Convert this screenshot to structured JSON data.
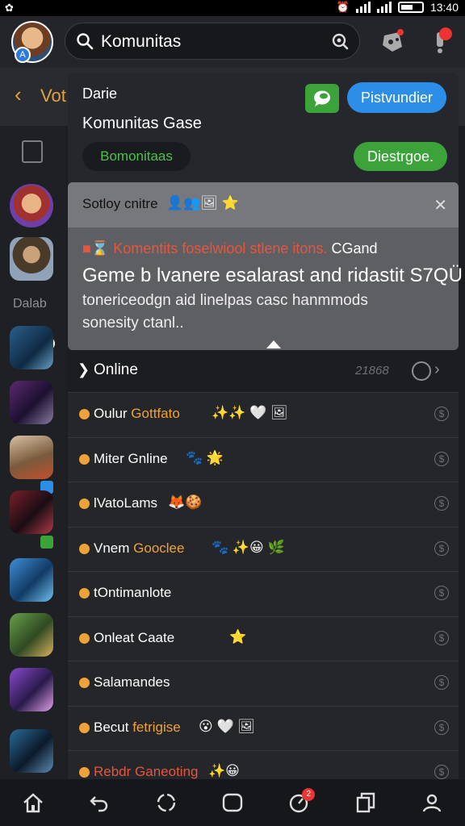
{
  "status_bar": {
    "time": "13:40"
  },
  "header": {
    "search_text": "Komunitas"
  },
  "back_row": {
    "label": "Vot"
  },
  "panel": {
    "title": "Darie",
    "subtitle": "Komunitas Gase",
    "blue_button": "Pistvundier",
    "chip_label": "Bomonitaas",
    "green_button": "Diestrgoe."
  },
  "tooltip": {
    "head_text": "Sotloy cnitre",
    "line1_red": "Komentits foselwiool stlene itons.",
    "line1_white": "CGand",
    "line2": "Geme b lvanere esalarast and ridastit S7QÜ",
    "line3": "tonericeodgn aid linelpas casc hanmmods",
    "line4": "sonesity ctanl.."
  },
  "rail": {
    "label": "Dalab"
  },
  "online": {
    "title": "Online",
    "count": "21868"
  },
  "rows": [
    {
      "name": "Oulur ",
      "accent": "Gottfato",
      "emoji": "✨✨ 🤍 🖼",
      "accent_color": "acc"
    },
    {
      "name": "Miter Gnline ",
      "accent": "",
      "emoji": "🐾 🌟",
      "accent_color": ""
    },
    {
      "name": "lVatoLams ",
      "accent": "",
      "emoji": "🦊🍪",
      "accent_color": ""
    },
    {
      "name": "Vnem ",
      "accent": "Gooclee",
      "emoji": "🐾 ✨😀   🌿",
      "accent_color": "acc"
    },
    {
      "name": "tOntimanlote",
      "accent": "",
      "emoji": "",
      "accent_color": ""
    },
    {
      "name": "Onleat Caate",
      "accent": "",
      "emoji": "⭐",
      "accent_color": ""
    },
    {
      "name": "Salamandes",
      "accent": "",
      "emoji": "",
      "accent_color": ""
    },
    {
      "name": "Becut ",
      "accent": "fetrigise",
      "emoji": "😮  🤍 🖼",
      "accent_color": "acc"
    },
    {
      "name": "",
      "accent": "Rebdr Ganeoting",
      "emoji": "✨😀",
      "accent_color": "red"
    }
  ],
  "bottom_nav": {
    "badge": "2"
  }
}
